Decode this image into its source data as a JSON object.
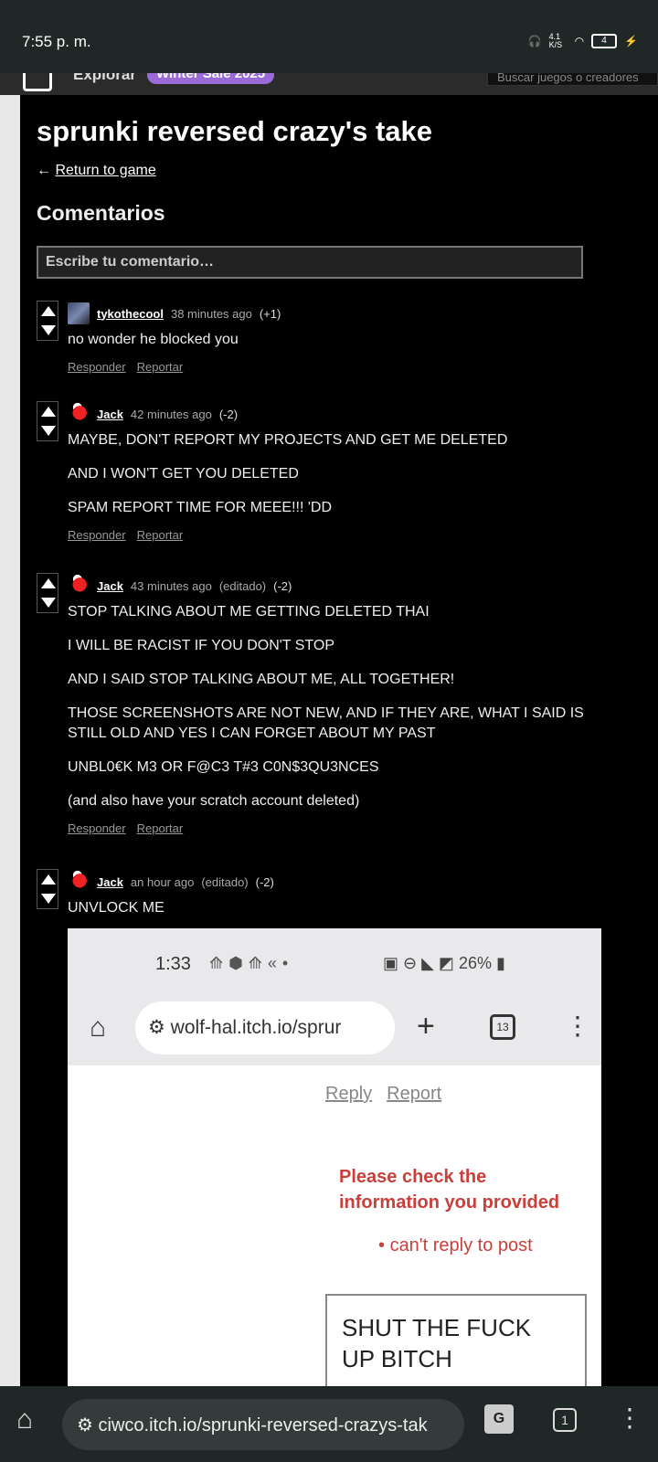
{
  "status": {
    "time": "7:55 p. m.",
    "speed": "4.1 K/S",
    "battery": "4"
  },
  "navbar": {
    "explorar": "Explorar",
    "sale": "Winter Sale 2025",
    "search_placeholder": "Buscar juegos o creadores"
  },
  "page": {
    "title": "sprunki reversed crazy's take",
    "return_arrow": "←",
    "return_label": "Return to game",
    "comments_heading": "Comentarios",
    "comment_placeholder": "Escribe tu comentario…"
  },
  "comments": [
    {
      "user": "tykothecool",
      "time": "38 minutes ago",
      "edited": "",
      "score": "(+1)",
      "lines": [
        "no wonder he blocked you"
      ]
    },
    {
      "user": "Jack",
      "time": "42 minutes ago",
      "edited": "",
      "score": "(-2)",
      "lines": [
        "MAYBE, DON'T REPORT MY PROJECTS AND GET ME DELETED",
        "AND I WON'T GET YOU DELETED",
        "SPAM REPORT TIME FOR MEEE!!! 'DD"
      ]
    },
    {
      "user": "Jack",
      "time": "43 minutes ago",
      "edited": "(editado)",
      "score": "(-2)",
      "lines": [
        "STOP TALKING ABOUT ME GETTING DELETED THAI",
        "I WILL BE RACIST IF YOU DON'T STOP",
        "AND I SAID STOP TALKING ABOUT ME, ALL TOGETHER!",
        "THOSE SCREENSHOTS ARE NOT NEW, AND IF THEY ARE, WHAT I SAID IS STILL OLD AND YES I CAN FORGET ABOUT MY PAST",
        "UNBL0€K M3 OR F@C3 T#3 C0N$3QU3NCES",
        "(and also have your scratch account deleted)"
      ]
    },
    {
      "user": "Jack",
      "time": "an hour ago",
      "edited": "(editado)",
      "score": "(-2)",
      "lines": [
        "UNVLOCK ME"
      ]
    }
  ],
  "actions": {
    "reply": "Responder",
    "report": "Reportar"
  },
  "screenshot": {
    "time": "1:33",
    "battery": "26%",
    "url": "wolf-hal.itch.io/sprur",
    "tab_count": "13",
    "reply": "Reply",
    "report": "Report",
    "error_title": "Please check the information you provided",
    "error_item": "can't reply to post",
    "textbox": "SHUT THE FUCK UP BITCH"
  },
  "browser": {
    "url": "ciwco.itch.io/sprunki-reversed-crazys-tak",
    "tab_count": "1"
  }
}
